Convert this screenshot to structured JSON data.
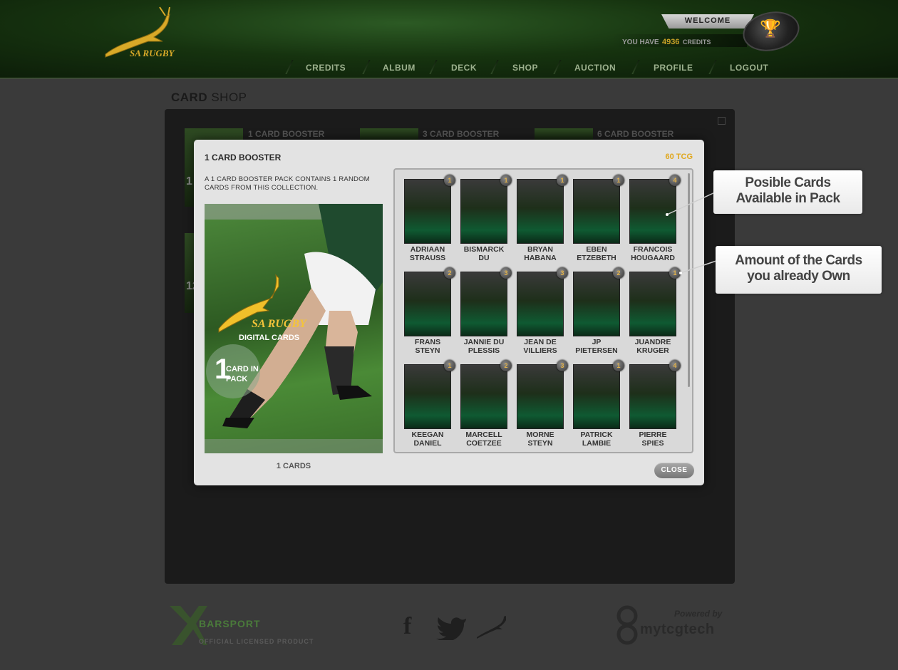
{
  "header": {
    "logo_text": "SA RUGBY",
    "welcome": "WELCOME",
    "credits_prefix": "YOU HAVE",
    "credits_amount": "4936",
    "credits_suffix": "CREDITS",
    "nav": [
      "CREDITS",
      "ALBUM",
      "DECK",
      "SHOP",
      "AUCTION",
      "PROFILE",
      "LOGOUT"
    ]
  },
  "page_title": {
    "bold": "CARD",
    "light": "SHOP"
  },
  "shop_panel": {
    "boosters": [
      "1 CARD BOOSTER",
      "3 CARD BOOSTER",
      "6 CARD BOOSTER"
    ],
    "side_counts": [
      "1",
      "12"
    ]
  },
  "modal": {
    "title": "1 CARD BOOSTER",
    "price": "60 TCG",
    "description": "A 1 CARD BOOSTER PACK CONTAINS 1 RANDOM CARDS FROM THIS COLLECTION.",
    "pack_brand": "SA RUGBY",
    "pack_sub": "DIGITAL CARDS",
    "pack_number": "1",
    "pack_label_1": "CARD IN",
    "pack_label_2": "PACK",
    "pack_count": "1 CARDS",
    "close": "CLOSE",
    "cards": [
      {
        "first": "ADRIAAN",
        "last": "STRAUSS",
        "count": "1"
      },
      {
        "first": "BISMARCK",
        "last": "DU",
        "count": "1"
      },
      {
        "first": "BRYAN",
        "last": "HABANA",
        "count": "1"
      },
      {
        "first": "EBEN",
        "last": "ETZEBETH",
        "count": "1"
      },
      {
        "first": "FRANCOIS",
        "last": "HOUGAARD",
        "count": "4"
      },
      {
        "first": "FRANS",
        "last": "STEYN",
        "count": "2"
      },
      {
        "first": "JANNIE DU",
        "last": "PLESSIS",
        "count": "3"
      },
      {
        "first": "JEAN DE",
        "last": "VILLIERS",
        "count": "3"
      },
      {
        "first": "JP",
        "last": "PIETERSEN",
        "count": "2"
      },
      {
        "first": "JUANDRE",
        "last": "KRUGER",
        "count": "1"
      },
      {
        "first": "KEEGAN",
        "last": "DANIEL",
        "count": "1"
      },
      {
        "first": "MARCELL",
        "last": "COETZEE",
        "count": "2"
      },
      {
        "first": "MORNE",
        "last": "STEYN",
        "count": "3"
      },
      {
        "first": "PATRICK",
        "last": "LAMBIE",
        "count": "1"
      },
      {
        "first": "PIERRE",
        "last": "SPIES",
        "count": "4"
      }
    ]
  },
  "callouts": {
    "possible_line1": "Posible Cards",
    "possible_line2": "Available in Pack",
    "owned_line1": "Amount of the Cards",
    "owned_line2": "you already Own"
  },
  "footer": {
    "xbar_brand": "BARSPORT",
    "xbar_sub": "OFFICIAL LICENSED PRODUCT",
    "powered_by": "Powered by",
    "tech_brand": "mytcgtech"
  },
  "colors": {
    "accent_gold": "#e0a820",
    "header_green": "#16330f",
    "modal_bg": "#e3e3e3"
  }
}
